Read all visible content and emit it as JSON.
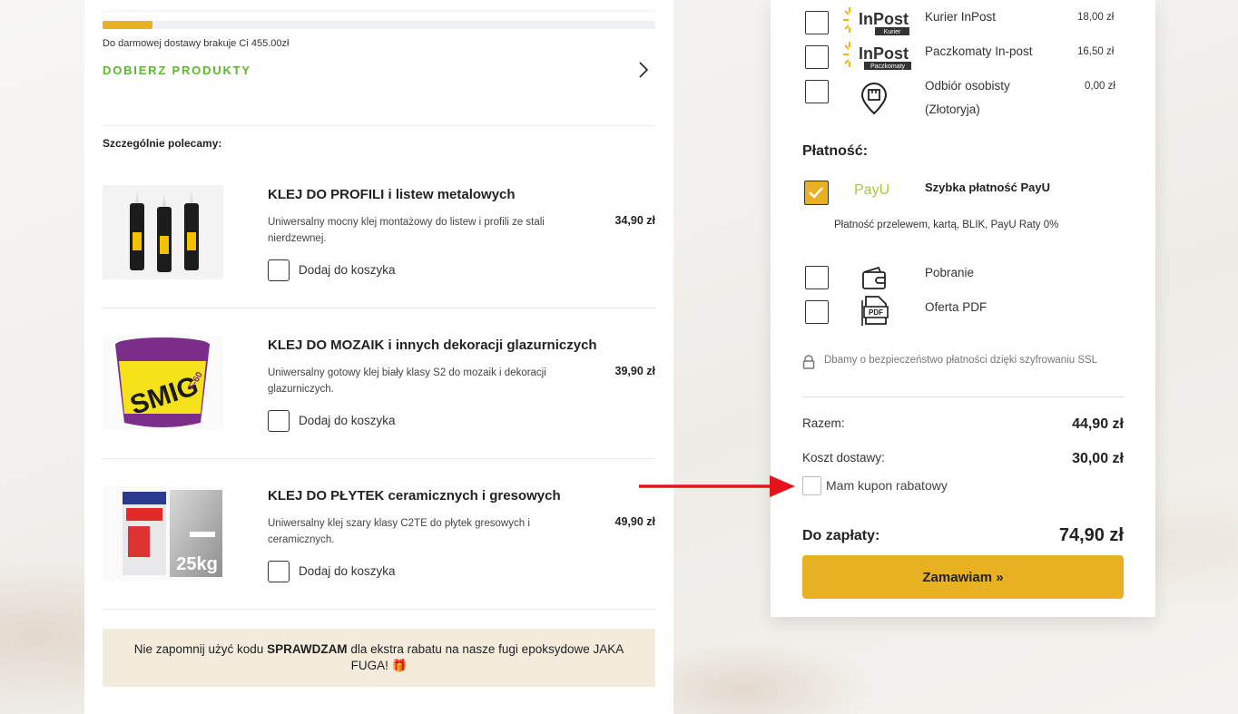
{
  "shipping_progress": {
    "fraction": 0.09,
    "message": "Do darmowej dostawy brakuje Ci 455.00zł",
    "link_label": "DOBIERZ PRODUKTY",
    "color": "#e8b122"
  },
  "recommendations": {
    "title": "Szczególnie polecamy:",
    "add_label": "Dodaj do koszyka",
    "products": [
      {
        "name": "KLEJ DO PROFILI i listew metalowych",
        "desc": "Uniwersalny mocny klej montażowy do listew i profili ze stali nierdzewnej.",
        "price": "34,90 zł",
        "image": "sealant-tubes"
      },
      {
        "name": "KLEJ DO MOZAIK i innych dekoracji glazurniczych",
        "desc": "Uniwersalny gotowy klej biały klasy S2 do mozaik i dekoracji glazurniczych.",
        "price": "39,90 zł",
        "image": "bucket",
        "image_text": "SMIG",
        "image_subtext": "F-60"
      },
      {
        "name": "KLEJ DO PŁYTEK ceramicznych i gresowych",
        "desc": "Uniwersalny klej szary klasy C2TE do płytek gresowych i ceramicznych.",
        "price": "49,90 zł",
        "image": "bag",
        "image_text": "25kg"
      }
    ]
  },
  "promo": {
    "before": "Nie zapomnij użyć kodu ",
    "code": "SPRAWDZAM",
    "after": " dla ekstra rabatu na nasze fugi epoksydowe JAKA FUGA! ",
    "emoji": "🎁"
  },
  "delivery": [
    {
      "label": "Kurier InPost",
      "price": "18,00 zł",
      "logo_text": "InPost",
      "logo_sub": "Kurier"
    },
    {
      "label": "Paczkomaty In-post",
      "price": "16,50 zł",
      "logo_text": "InPost",
      "logo_sub": "Paczkomaty"
    },
    {
      "label": "Odbiór osobisty (Złotoryja)",
      "price": "0,00 zł",
      "icon": "pickup-pin-icon"
    }
  ],
  "payment": {
    "title": "Płatność:",
    "payu_label": "Szybka płatność PayU",
    "payu_logo": "PayU",
    "payu_desc": "Płatność przelewem, kartą, BLIK, PayU Raty 0%",
    "options": [
      {
        "label": "Pobranie",
        "icon": "wallet-icon"
      },
      {
        "label": "Oferta PDF",
        "icon": "pdf-icon",
        "icon_text": "PDF"
      }
    ],
    "ssl_note": "Dbamy o bezpieczeństwo płatności dzięki szyfrowaniu SSL"
  },
  "summary": {
    "subtotal_label": "Razem:",
    "subtotal_value": "44,90 zł",
    "shipping_label": "Koszt dostawy:",
    "shipping_value": "30,00 zł",
    "coupon_label": "Mam kupon rabatowy",
    "total_label": "Do zapłaty:",
    "total_value": "74,90 zł",
    "order_button": "Zamawiam »"
  },
  "colors": {
    "accent": "#e8b122",
    "link_green": "#5cb82e",
    "arrow": "#e3141b",
    "promo_bg": "#f3ecdd"
  }
}
